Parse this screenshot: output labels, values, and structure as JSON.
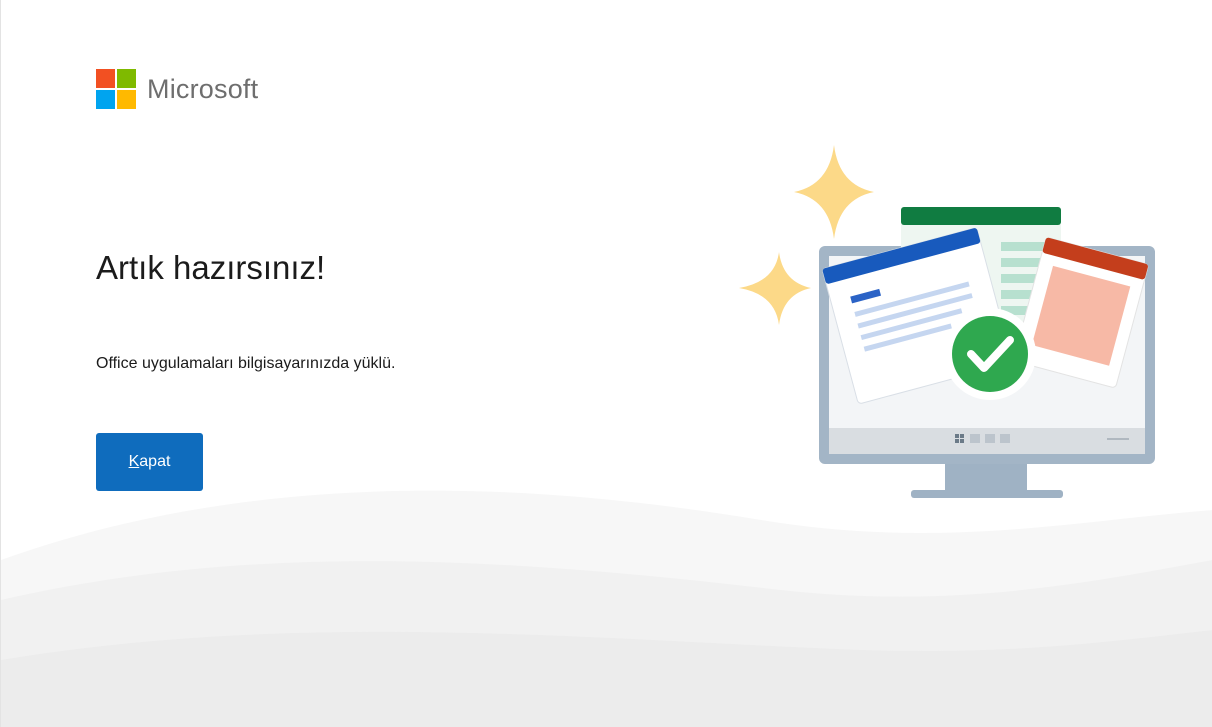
{
  "brand": {
    "name": "Microsoft",
    "logo_colors": [
      "#f25022",
      "#7fba00",
      "#00a4ef",
      "#ffb900"
    ]
  },
  "main": {
    "title": "Artık hazırsınız!",
    "message": "Office uygulamaları bilgisayarınızda yüklü."
  },
  "actions": {
    "close": {
      "access_key": "K",
      "rest": "apat",
      "color": "#0f6cbd"
    }
  },
  "illustration": {
    "icons": [
      "sparkle-icon",
      "monitor-icon",
      "word-document-icon",
      "excel-document-icon",
      "powerpoint-document-icon",
      "checkmark-icon",
      "windows-icon"
    ],
    "colors": {
      "sparkle": "#fcd988",
      "word": "#185abd",
      "excel": "#107c41",
      "powerpoint": "#c43e1c",
      "check": "#2fa84f",
      "monitor": "#9fb2c4"
    }
  }
}
